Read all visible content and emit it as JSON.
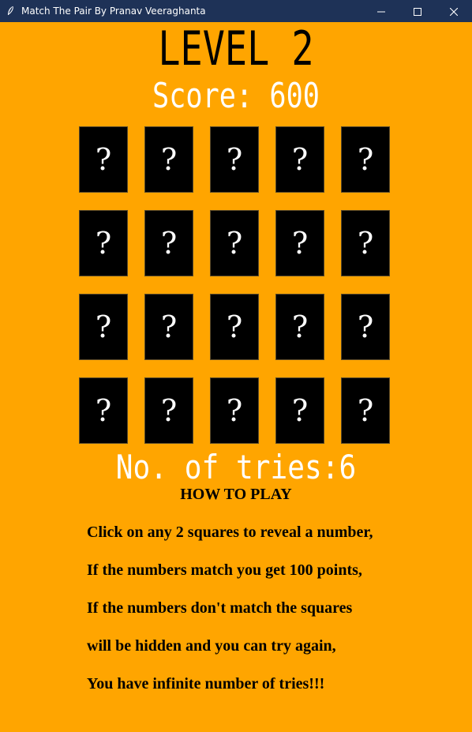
{
  "window": {
    "title": "Match The Pair By Pranav Veeraghanta",
    "app_icon": "feather-icon",
    "controls": [
      "minimize-icon",
      "maximize-icon",
      "close-icon"
    ]
  },
  "game": {
    "level_text": "LEVEL 2",
    "score_text": "Score: 600",
    "tries_text": "No. of tries:6",
    "grid": {
      "rows": 4,
      "cols": 5,
      "hidden_symbol": "?"
    }
  },
  "instructions": {
    "title": "HOW TO PLAY",
    "lines": [
      "Click on any 2 squares to reveal a number,",
      "If the numbers match you get 100 points,",
      "If the numbers don't match the squares",
      "will be hidden and you can try again,",
      "You have infinite number of tries!!!"
    ]
  },
  "colors": {
    "background": "#ffa500",
    "titlebar": "#1e3257",
    "tile": "#000000",
    "tile_text": "#ffffff",
    "score_text": "#ffffff",
    "level_text": "#000000"
  }
}
